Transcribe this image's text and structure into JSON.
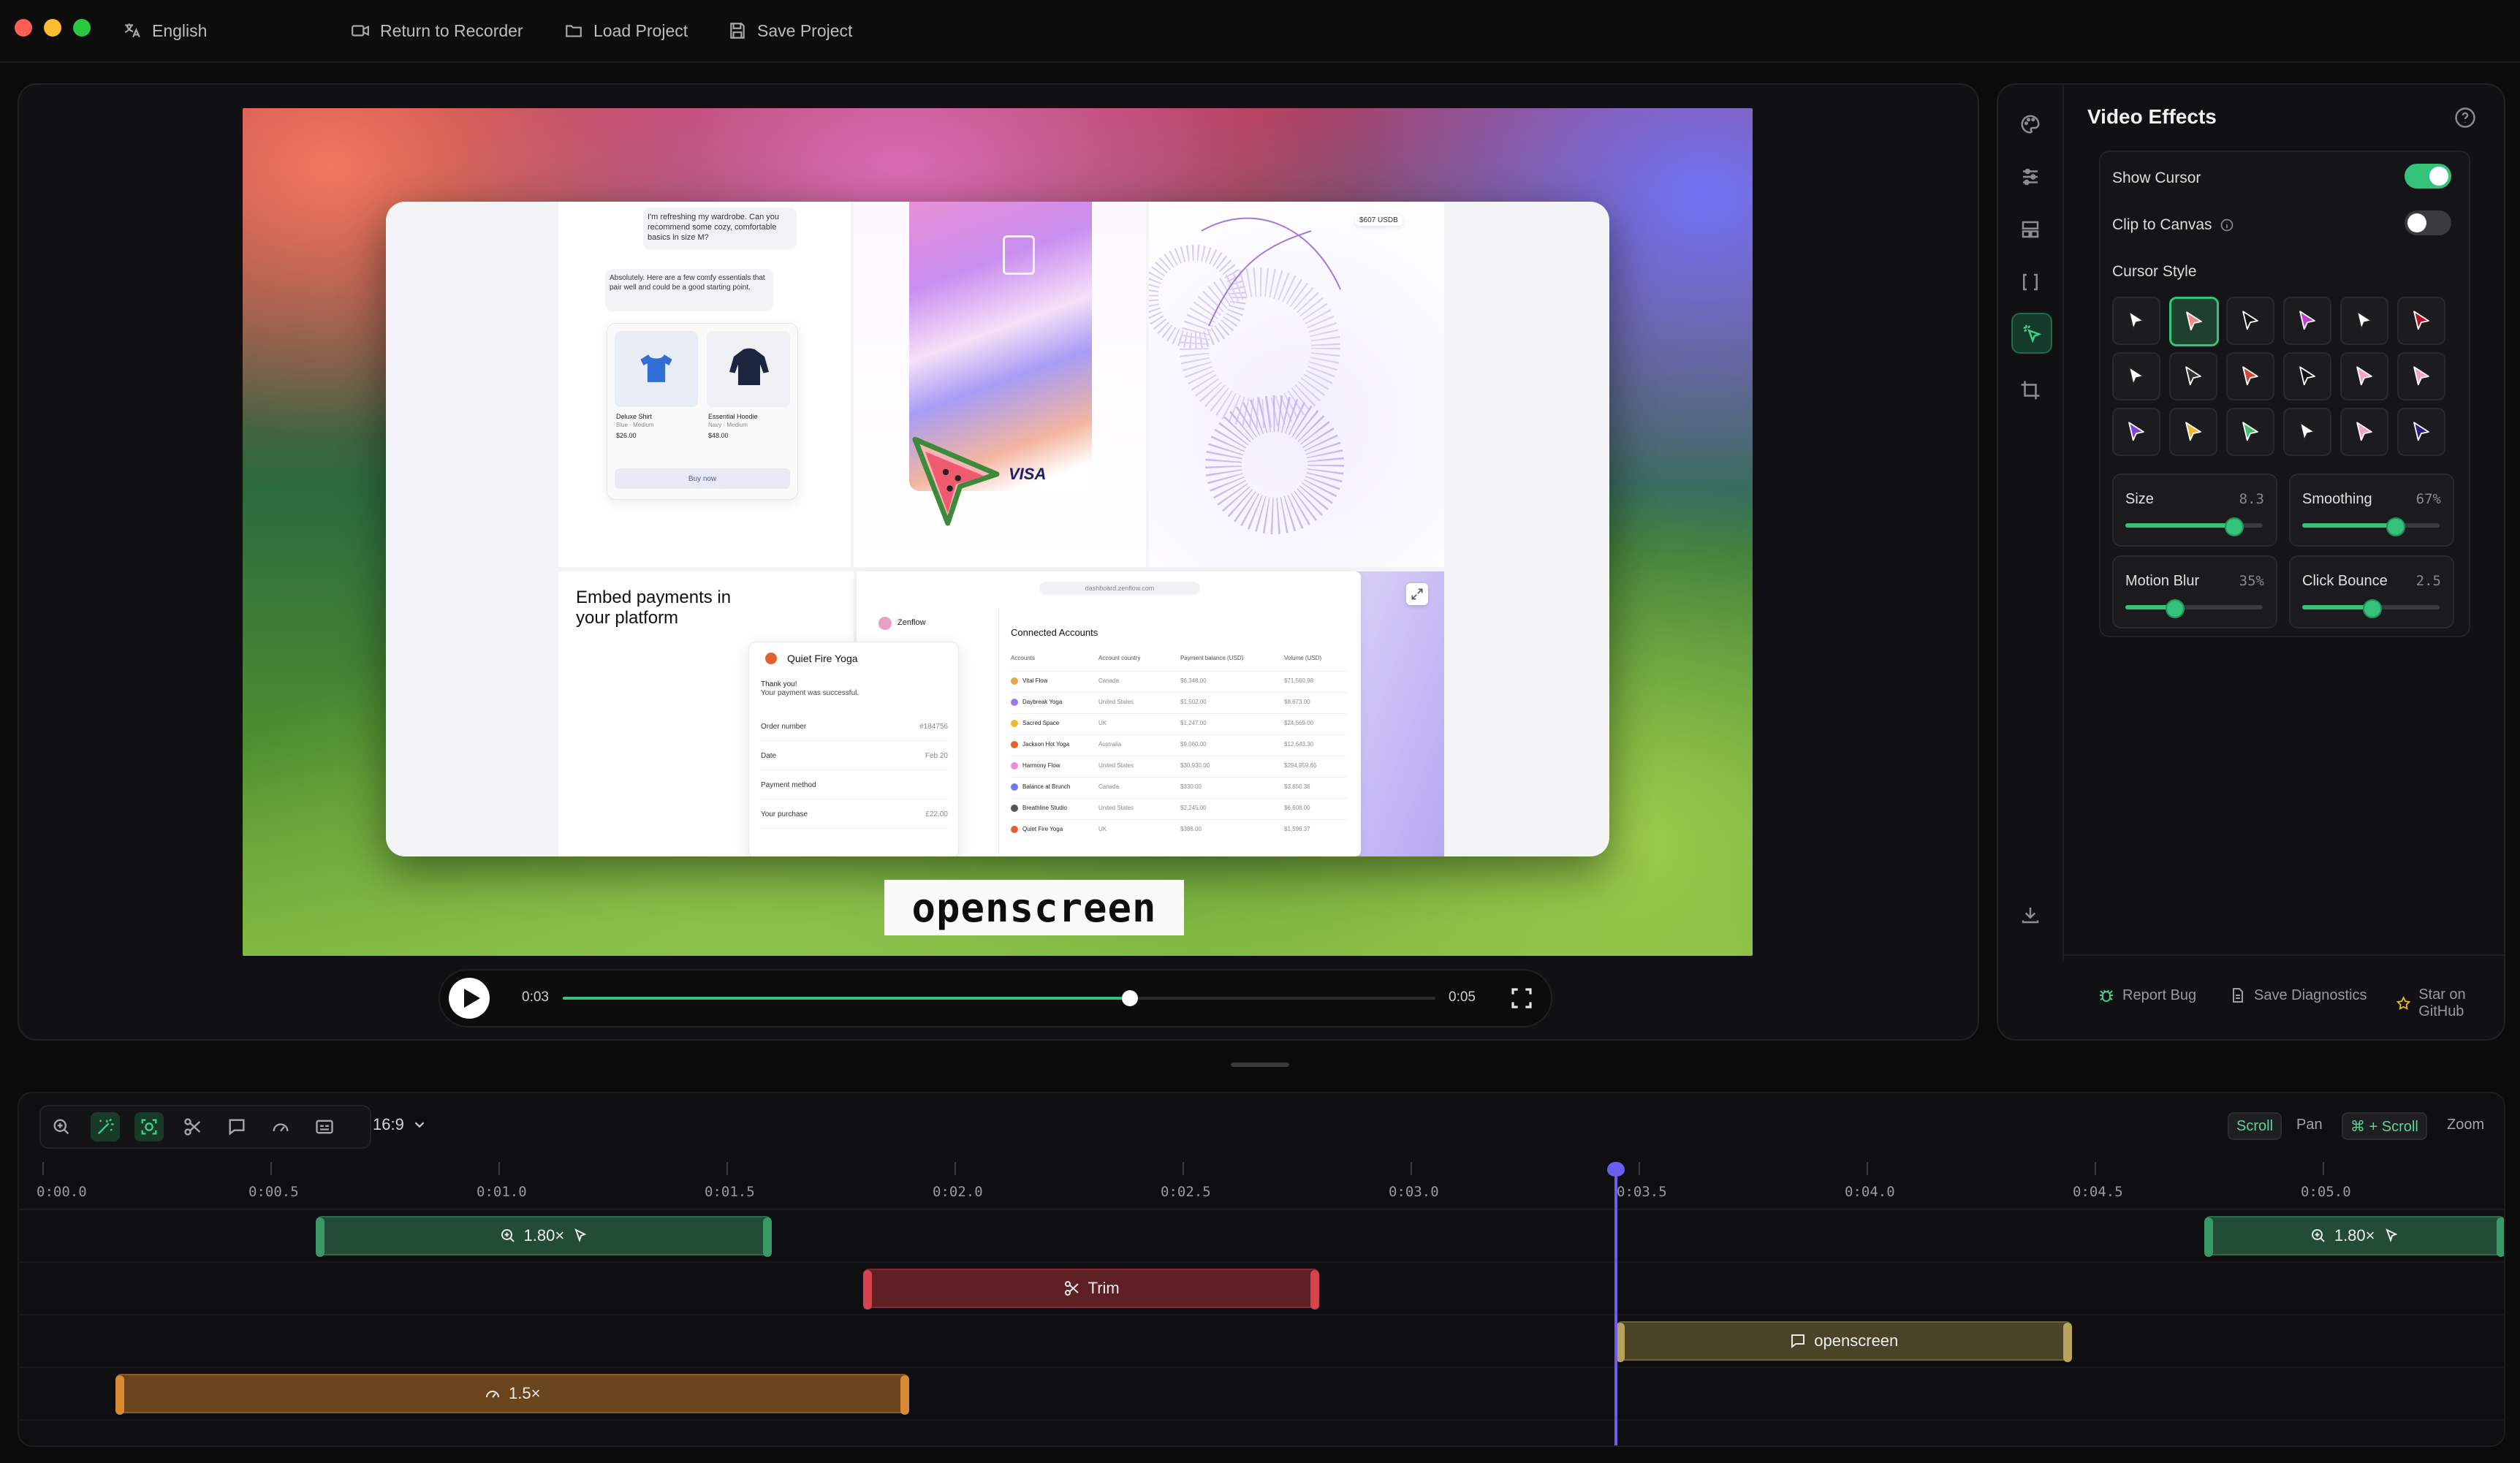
{
  "titlebar": {
    "language_label": "English",
    "return_label": "Return to Recorder",
    "load_label": "Load Project",
    "save_label": "Save Project"
  },
  "canvas": {
    "caption_text": "openscreen",
    "inner": {
      "chat_user": "I'm refreshing my wardrobe. Can you recommend some cozy, comfortable basics in size M?",
      "chat_bot": "Absolutely. Here are a few comfy essentials that pair well and could be a good starting point.",
      "product_1_name": "Deluxe Shirt",
      "product_1_detail": "Blue · Medium",
      "product_1_price": "$26.00",
      "product_2_name": "Essential Hoodie",
      "product_2_detail": "Navy · Medium",
      "product_2_price": "$48.00",
      "buy_label": "Buy now",
      "card_brand": "VISA",
      "map_badge": "$607 USDB",
      "embed_heading": "Embed payments in your platform",
      "receipt_title": "Quiet Fire Yoga",
      "receipt_thanks": "Thank you!",
      "receipt_msg": "Your payment was successful.",
      "receipt_rows": [
        {
          "k": "Order number",
          "v": "#184756"
        },
        {
          "k": "Date",
          "v": "Feb 20"
        },
        {
          "k": "Payment method",
          "v": ""
        },
        {
          "k": "Your purchase",
          "v": "£22.00"
        }
      ],
      "dash_url": "dashboard.zenflow.com",
      "dash_brand": "Zenflow",
      "dash_title": "Connected Accounts",
      "dash_columns": [
        "Accounts",
        "Account country",
        "Payment balance (USD)",
        "Volume (USD)"
      ],
      "dash_rows": [
        [
          "Vital Flow",
          "Canada",
          "$6,348.00",
          "$71,560.98"
        ],
        [
          "Daybreak Yoga",
          "United States",
          "$1,502.00",
          "$8,673.00"
        ],
        [
          "Sacred Space",
          "UK",
          "$1,247.00",
          "$24,569.00"
        ],
        [
          "Jackson Hot Yoga",
          "Australia",
          "$9,060.00",
          "$12,643.30"
        ],
        [
          "Harmony Flow",
          "United States",
          "$30,930.00",
          "$294,959.65"
        ],
        [
          "Balance at Brunch",
          "Canada",
          "$330.00",
          "$3,650.36"
        ],
        [
          "Breathline Studio",
          "United States",
          "$2,245.00",
          "$6,608.00"
        ],
        [
          "Quiet Fire Yoga",
          "UK",
          "$388.00",
          "$1,596.37"
        ]
      ]
    }
  },
  "player": {
    "current_time": "0:03",
    "duration": "0:05",
    "progress": 0.65
  },
  "effects": {
    "title": "Video Effects",
    "show_cursor_label": "Show Cursor",
    "show_cursor_on": true,
    "clip_canvas_label": "Clip to Canvas",
    "clip_canvas_on": false,
    "cursor_style_label": "Cursor Style",
    "selected_cursor_index": 1,
    "cursor_colors": [
      "#ffffff",
      "#f08a8a",
      "#111111",
      "#c43ad6",
      "#ffffff",
      "#b7102a",
      "#ffffff",
      "#333333",
      "#d6453b",
      "#111111",
      "#f2a3c6",
      "#f2a3c6",
      "#7d46d9",
      "#f1b82d",
      "#3fbf6b",
      "#ffffff",
      "#f2a3c6",
      "#2d1f8a"
    ],
    "sliders": [
      {
        "label": "Size",
        "value_text": "8.3",
        "fraction": 0.78
      },
      {
        "label": "Smoothing",
        "value_text": "67%",
        "fraction": 0.67
      },
      {
        "label": "Motion Blur",
        "value_text": "35%",
        "fraction": 0.35
      },
      {
        "label": "Click Bounce",
        "value_text": "2.5",
        "fraction": 0.5
      }
    ],
    "footer": {
      "report_bug": "Report Bug",
      "save_diagnostics": "Save Diagnostics",
      "star_github": "Star on GitHub"
    }
  },
  "timeline": {
    "aspect_ratio": "16:9",
    "hints": {
      "scroll_key": "Scroll",
      "scroll_action": "Pan",
      "cmd_scroll_key": "⌘ + Scroll",
      "cmd_scroll_action": "Zoom"
    },
    "ticks": [
      "0:00.0",
      "0:00.5",
      "0:01.0",
      "0:01.5",
      "0:02.0",
      "0:02.5",
      "0:03.0",
      "0:03.5",
      "0:04.0",
      "0:04.5",
      "0:05.0"
    ],
    "playhead_time": 3.45,
    "zoom_clips": [
      {
        "label": "1.80×",
        "start": 0.6,
        "end": 1.6
      },
      {
        "label": "1.80×",
        "start": 4.74,
        "end": 5.4
      }
    ],
    "trim_clips": [
      {
        "label": "Trim",
        "start": 1.8,
        "end": 2.8
      }
    ],
    "annotation_clips": [
      {
        "label": "openscreen",
        "start": 3.45,
        "end": 4.45
      }
    ],
    "speed_clips": [
      {
        "label": "1.5×",
        "start": 0.16,
        "end": 1.9
      }
    ]
  }
}
